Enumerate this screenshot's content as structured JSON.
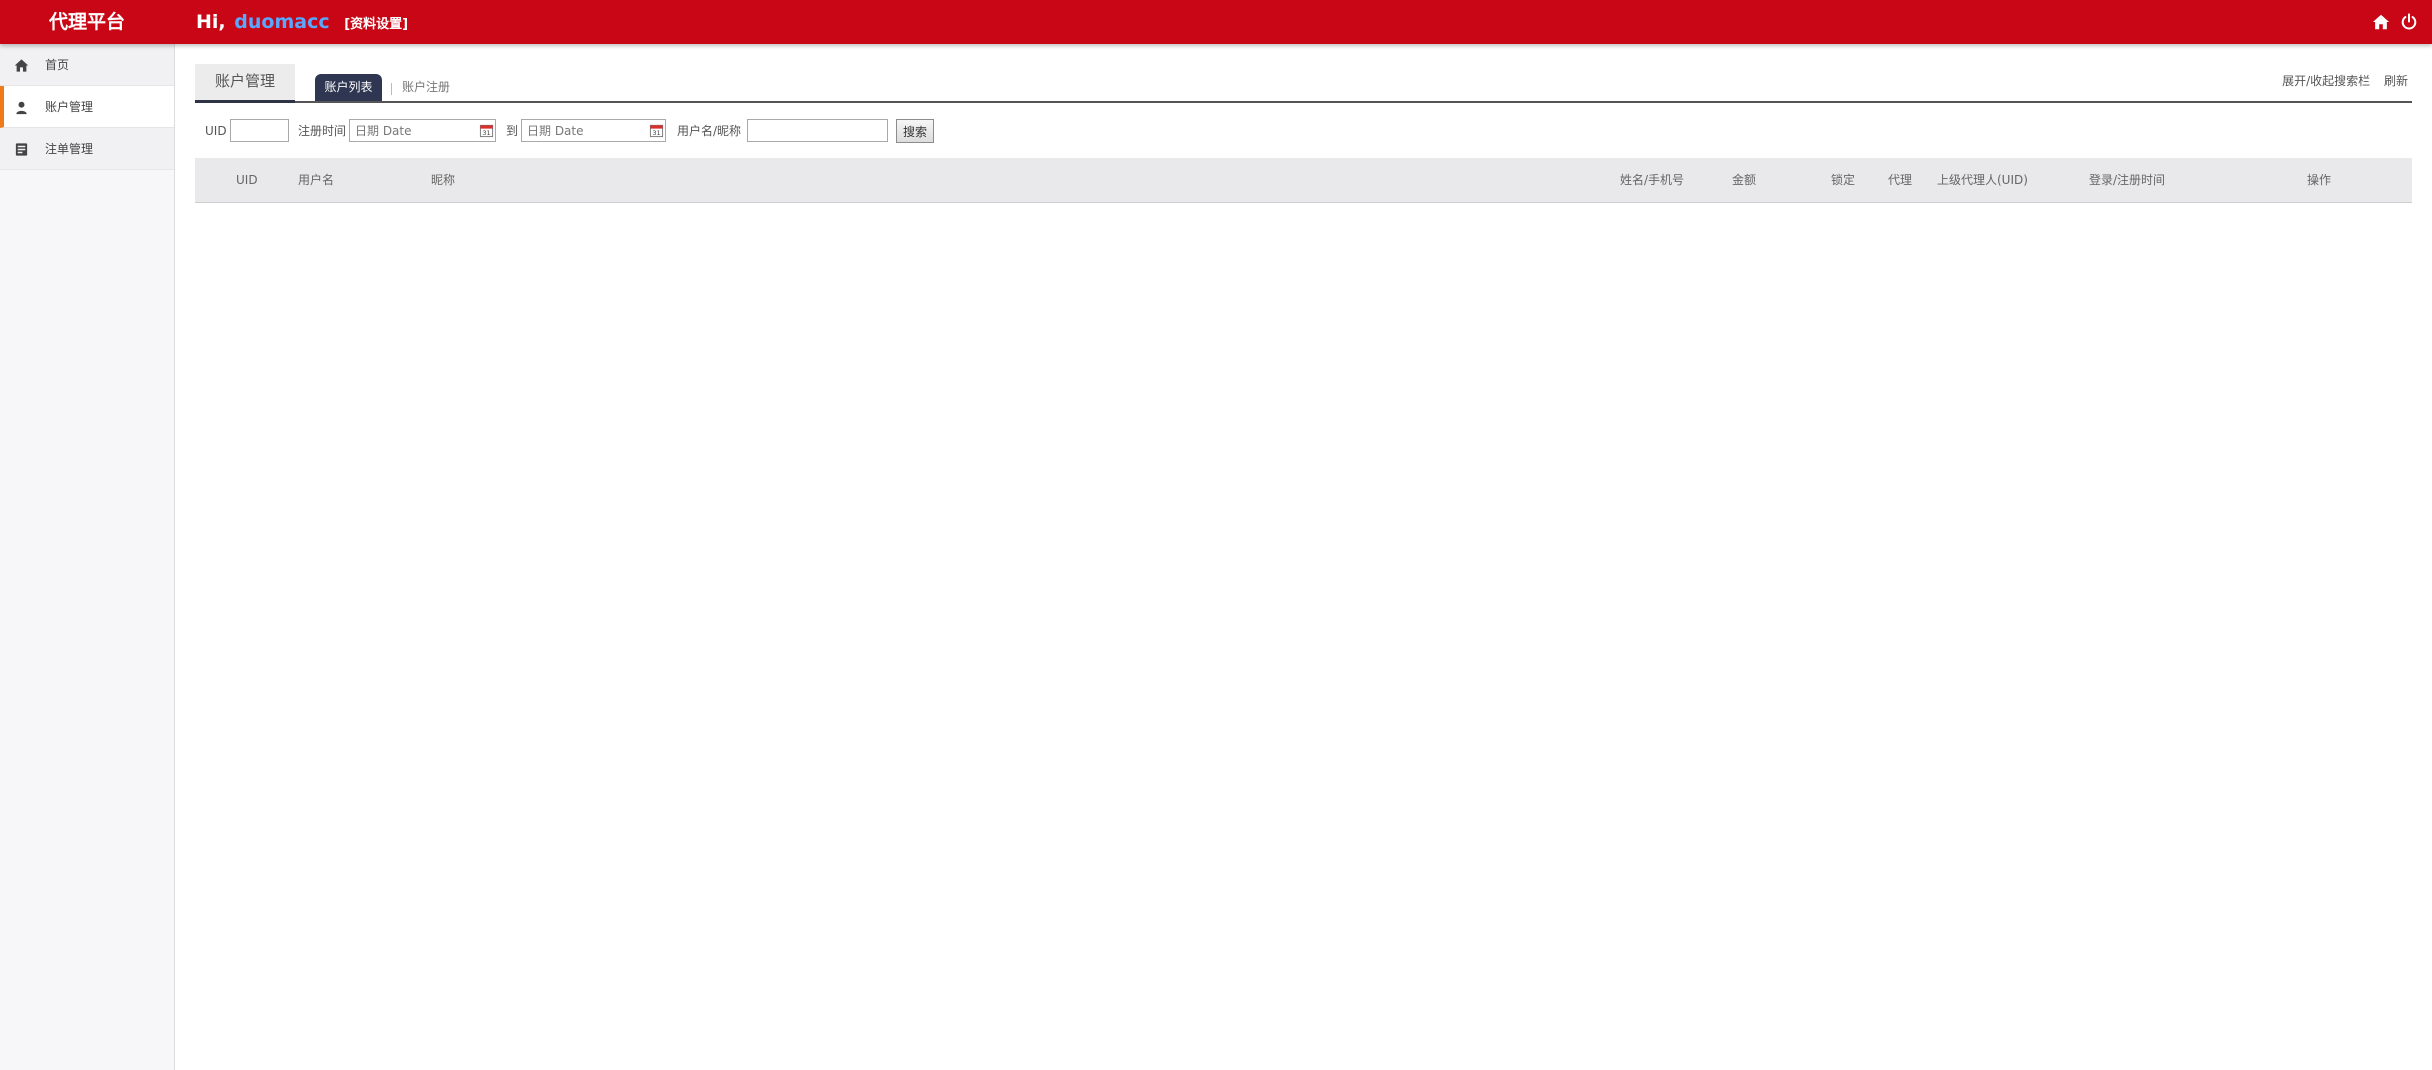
{
  "header": {
    "brand": "代理平台",
    "greeting_prefix": "Hi,",
    "username": "duomacc",
    "profile_link": "[资料设置]",
    "icons": [
      "home-icon",
      "power-icon"
    ]
  },
  "sidebar": {
    "items": [
      {
        "label": "首页",
        "icon": "home-icon",
        "active": false
      },
      {
        "label": "账户管理",
        "icon": "user-icon",
        "active": true
      },
      {
        "label": "注单管理",
        "icon": "ledger-icon",
        "active": false
      }
    ]
  },
  "tabs": {
    "main_tab": "账户管理",
    "sub_tabs": [
      {
        "label": "账户列表",
        "active": true
      },
      {
        "label": "账户注册",
        "active": false
      }
    ],
    "actions": {
      "toggle_search": "展开/收起搜索栏",
      "refresh": "刷新"
    }
  },
  "search": {
    "uid_label": "UID",
    "uid_value": "",
    "reg_time_label": "注册时间",
    "date_from_placeholder": "日期 Date",
    "to_label": "到",
    "date_to_placeholder": "日期 Date",
    "name_label": "用户名/昵称",
    "name_value": "",
    "search_button": "搜索"
  },
  "table": {
    "columns": [
      "UID",
      "用户名",
      "昵称",
      "姓名/手机号",
      "金额",
      "锁定",
      "代理",
      "上级代理人(UID)",
      "登录/注册时间",
      "操作"
    ],
    "rows": []
  },
  "colors": {
    "header_bg": "#c90615",
    "username": "#5aa7ff",
    "active_subtab": "#2f3651",
    "sidebar_active_marker": "#f07b1a"
  }
}
